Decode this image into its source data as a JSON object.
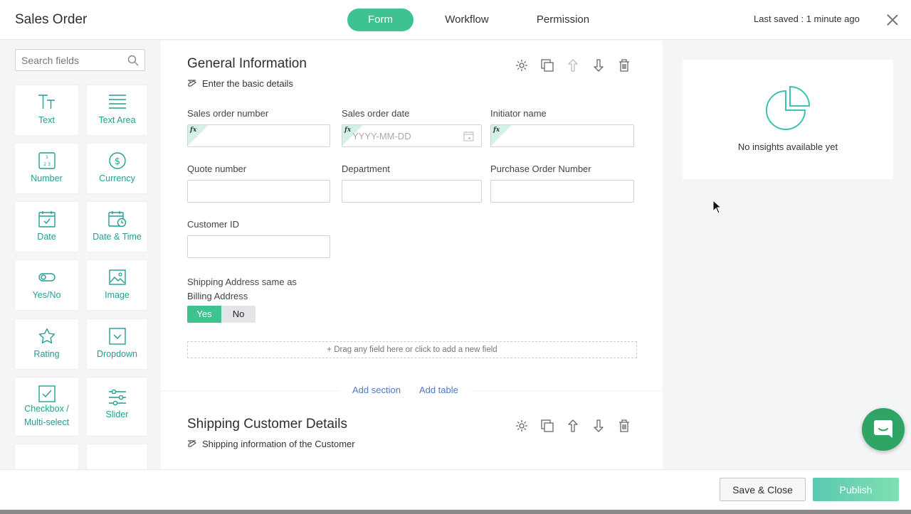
{
  "header": {
    "title": "Sales Order",
    "tabs": [
      {
        "label": "Form"
      },
      {
        "label": "Workflow"
      },
      {
        "label": "Permission"
      }
    ],
    "last_saved": "Last saved : 1 minute ago"
  },
  "sidebar": {
    "search_placeholder": "Search fields",
    "fields": [
      {
        "label": "Text",
        "icon": "text-icon"
      },
      {
        "label": "Text Area",
        "icon": "text-area-icon"
      },
      {
        "label": "Number",
        "icon": "number-icon"
      },
      {
        "label": "Currency",
        "icon": "currency-icon"
      },
      {
        "label": "Date",
        "icon": "date-icon"
      },
      {
        "label": "Date & Time",
        "icon": "date-time-icon"
      },
      {
        "label": "Yes/No",
        "icon": "toggle-icon"
      },
      {
        "label": "Image",
        "icon": "image-icon"
      },
      {
        "label": "Rating",
        "icon": "star-icon"
      },
      {
        "label": "Dropdown",
        "icon": "dropdown-icon"
      },
      {
        "label": "Checkbox / Multi-select",
        "icon": "checkbox-icon"
      },
      {
        "label": "Slider",
        "icon": "slider-icon"
      }
    ]
  },
  "sections": [
    {
      "title": "General Information",
      "description": "Enter the basic details",
      "fields": [
        {
          "label": "Sales order number",
          "formula": true,
          "placeholder": ""
        },
        {
          "label": "Sales order date",
          "formula": true,
          "placeholder": "YYYY-MM-DD"
        },
        {
          "label": "Initiator name",
          "formula": true,
          "placeholder": ""
        },
        {
          "label": "Quote number",
          "placeholder": ""
        },
        {
          "label": "Department",
          "placeholder": ""
        },
        {
          "label": "Purchase Order Number",
          "placeholder": ""
        },
        {
          "label": "Customer ID",
          "placeholder": ""
        }
      ],
      "toggle_field": {
        "label_line1": "Shipping Address same as",
        "label_line2": "Billing Address",
        "yes": "Yes",
        "no": "No",
        "selected": "Yes"
      },
      "dropzone": "Drag any field here or click to add a new field"
    },
    {
      "title": "Shipping Customer Details",
      "description": "Shipping information of the Customer"
    }
  ],
  "add_links": {
    "section": "Add section",
    "table": "Add table"
  },
  "insights": {
    "empty_text": "No insights available yet"
  },
  "footer": {
    "save_close": "Save & Close",
    "publish": "Publish"
  },
  "colors": {
    "accent": "#3ec28f",
    "teal": "#1f9e93",
    "link": "#4a79c7",
    "chat": "#2ea564"
  }
}
